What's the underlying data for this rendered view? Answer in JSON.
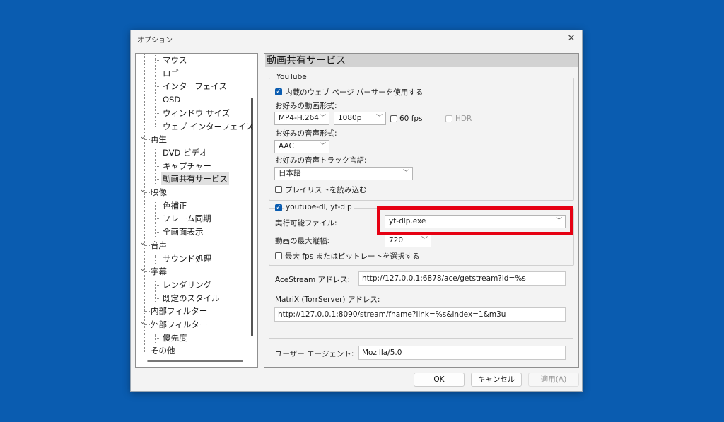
{
  "dialog": {
    "title": "オプション"
  },
  "tree": {
    "items": [
      {
        "label": "マウス",
        "level": 2
      },
      {
        "label": "ロゴ",
        "level": 2
      },
      {
        "label": "インターフェイス",
        "level": 2
      },
      {
        "label": "OSD",
        "level": 2
      },
      {
        "label": "ウィンドウ サイズ",
        "level": 2
      },
      {
        "label": "ウェブ インターフェイス",
        "level": 2
      },
      {
        "label": "再生",
        "level": 1,
        "expanded": true
      },
      {
        "label": "DVD ビデオ",
        "level": 2
      },
      {
        "label": "キャプチャー",
        "level": 2
      },
      {
        "label": "動画共有サービス",
        "level": 2,
        "selected": true
      },
      {
        "label": "映像",
        "level": 1,
        "expanded": true
      },
      {
        "label": "色補正",
        "level": 2
      },
      {
        "label": "フレーム同期",
        "level": 2
      },
      {
        "label": "全画面表示",
        "level": 2
      },
      {
        "label": "音声",
        "level": 1,
        "expanded": true
      },
      {
        "label": "サウンド処理",
        "level": 2
      },
      {
        "label": "字幕",
        "level": 1,
        "expanded": true
      },
      {
        "label": "レンダリング",
        "level": 2
      },
      {
        "label": "既定のスタイル",
        "level": 2
      },
      {
        "label": "内部フィルター",
        "level": 1
      },
      {
        "label": "外部フィルター",
        "level": 1,
        "expanded": true
      },
      {
        "label": "優先度",
        "level": 2
      },
      {
        "label": "その他",
        "level": 1
      }
    ]
  },
  "panel": {
    "heading": "動画共有サービス",
    "youtube": {
      "group_title": "YouTube",
      "use_parser_label": "内蔵のウェブ ページ パーサーを使用する",
      "video_format_label": "お好みの動画形式:",
      "video_format_value": "MP4-H.264",
      "resolution_value": "1080p",
      "fps60_label": "60 fps",
      "hdr_label": "HDR",
      "audio_format_label": "お好みの音声形式:",
      "audio_format_value": "AAC",
      "audio_lang_label": "お好みの音声トラック言語:",
      "audio_lang_value": "日本語",
      "playlist_label": "プレイリストを読み込む"
    },
    "ytdlp": {
      "group_title": "youtube-dl, yt-dlp",
      "exe_label": "実行可能ファイル:",
      "exe_value": "yt-dlp.exe",
      "max_height_label": "動画の最大縦幅:",
      "max_height_value": "720",
      "max_fps_label": "最大 fps またはビットレートを選択する"
    },
    "acestream_label": "AceStream アドレス:",
    "acestream_value": "http://127.0.0.1:6878/ace/getstream?id=%s",
    "matrix_label": "MatriX (TorrServer) アドレス:",
    "matrix_value": "http://127.0.0.1:8090/stream/fname?link=%s&index=1&m3u",
    "useragent_label": "ユーザー エージェント:",
    "useragent_value": "Mozilla/5.0"
  },
  "buttons": {
    "ok": "OK",
    "cancel": "キャンセル",
    "apply": "適用(A)"
  },
  "colors": {
    "background": "#0a5cb0",
    "highlight": "#e60012",
    "checkbox": "#0a5cb0"
  }
}
